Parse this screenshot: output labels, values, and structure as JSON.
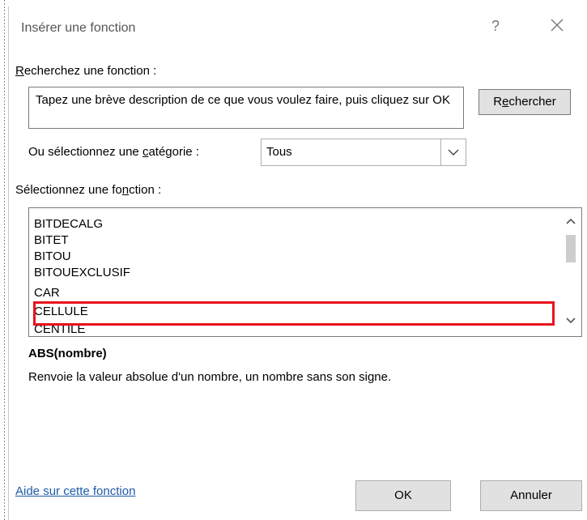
{
  "dialog": {
    "title": "Insérer une fonction",
    "help_glyph": "?",
    "close_glyph": "✕"
  },
  "search": {
    "label_first": "R",
    "label_rest": "echerchez une fonction :",
    "box_text": "Tapez une brève description de ce que vous voulez faire, puis cliquez sur OK",
    "button_first": "R",
    "button_u": "e",
    "button_rest": "chercher"
  },
  "category": {
    "label_pre": "Ou sélectionnez une ",
    "label_u": "c",
    "label_post": "atégorie :",
    "selected": "Tous"
  },
  "functions": {
    "label_pre": "Sélectionnez une fo",
    "label_u": "n",
    "label_post": "ction :",
    "items": [
      "BITDECALG",
      "BITET",
      "BITOU",
      "BITOUEXCLUSIF",
      "CAR",
      "CELLULE",
      "CENTILE"
    ],
    "highlighted": "CELLULE",
    "syntax": "ABS(nombre)",
    "description": "Renvoie la valeur absolue d'un nombre, un nombre sans son signe."
  },
  "footer": {
    "help_link": "Aide sur cette fonction",
    "ok": "OK",
    "cancel": "Annuler"
  },
  "colors": {
    "highlight": "#e8131b",
    "link": "#1e5aa8",
    "button_bg": "#e1e1e1"
  }
}
